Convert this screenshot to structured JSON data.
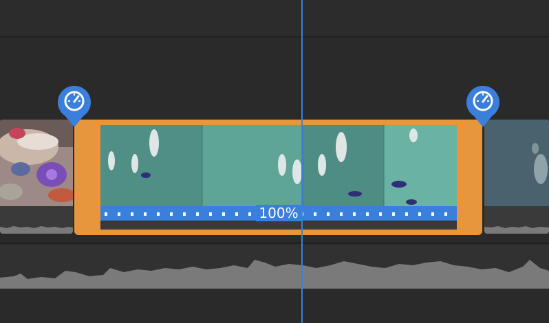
{
  "timeline": {
    "selected_clip": {
      "speed_label": "100%"
    },
    "speed_markers": [
      {
        "icon": "speedometer-icon"
      },
      {
        "icon": "speedometer-icon"
      }
    ]
  },
  "colors": {
    "background": "#2a2a2a",
    "selection": "#e8963c",
    "speed_bar": "#3a7fdc",
    "playhead": "#3f7fd6",
    "waveform": "#7a7a7a"
  }
}
